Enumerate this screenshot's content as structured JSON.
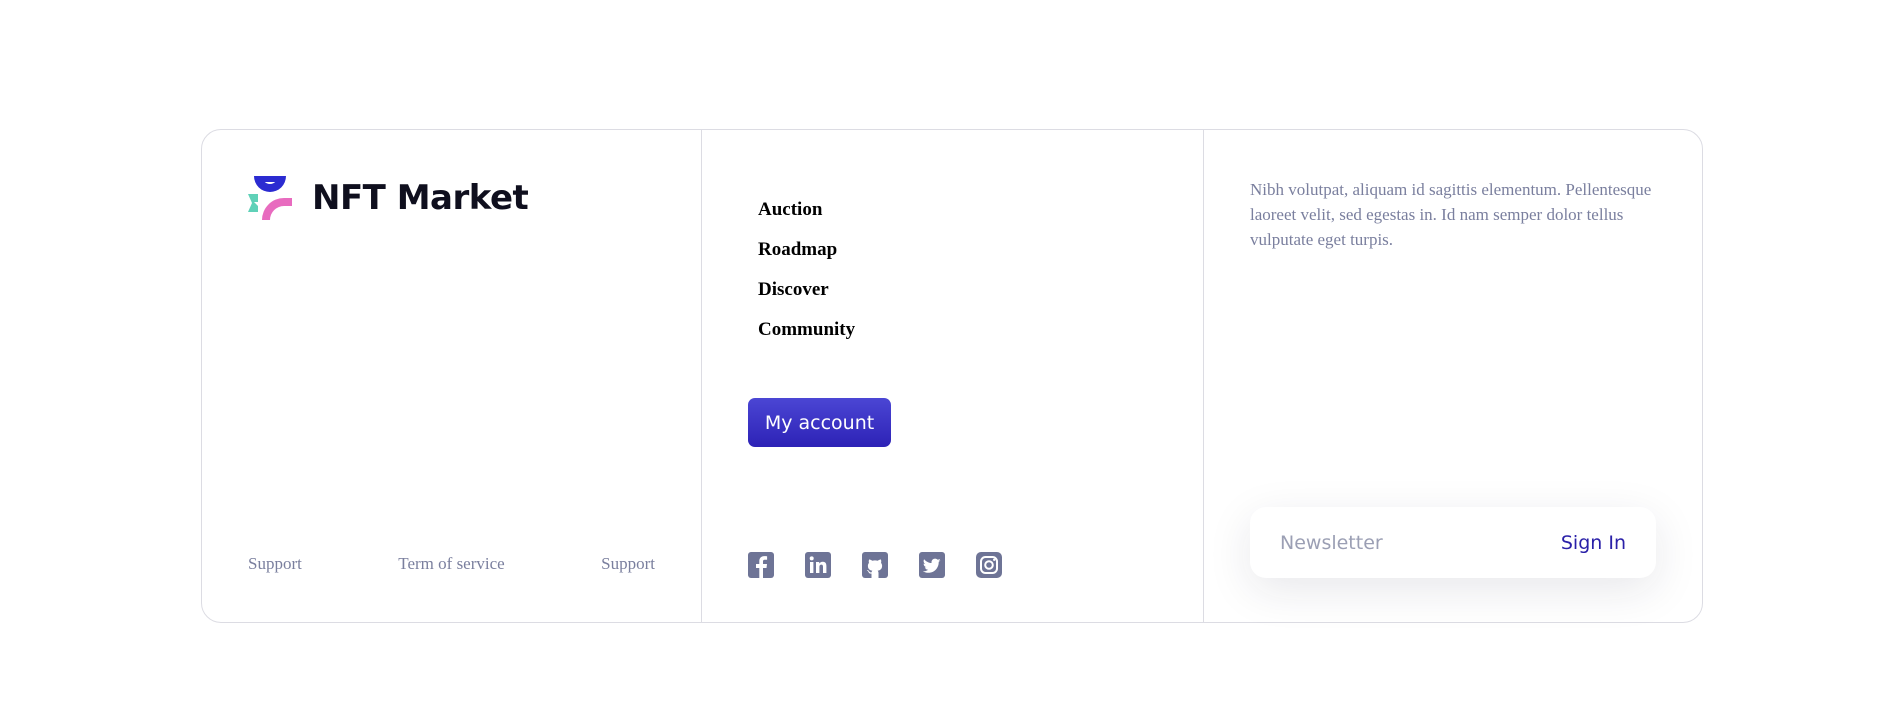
{
  "brand": {
    "name": "NFT Market",
    "logo_icon": "nft-market-logo-icon"
  },
  "legal_links": [
    {
      "label": "Support"
    },
    {
      "label": "Term of service"
    },
    {
      "label": "Support"
    }
  ],
  "nav": {
    "items": [
      {
        "label": "Auction"
      },
      {
        "label": "Roadmap"
      },
      {
        "label": "Discover"
      },
      {
        "label": "Community"
      }
    ]
  },
  "account": {
    "button_label": "My account"
  },
  "social": {
    "icons": [
      "facebook-icon",
      "linkedin-icon",
      "github-icon",
      "twitter-icon",
      "instagram-icon"
    ]
  },
  "about": {
    "text": "Nibh volutpat, aliquam id sagittis elementum. Pellentesque laoreet velit, sed egestas in. Id nam semper dolor tellus vulputate eget turpis."
  },
  "newsletter": {
    "placeholder": "Newsletter",
    "value": "",
    "submit_label": "Sign In"
  },
  "colors": {
    "accent": "#2d22b6",
    "muted_text": "#7a7f9e",
    "social_icon": "#6e7496",
    "border": "#dcdce3"
  }
}
